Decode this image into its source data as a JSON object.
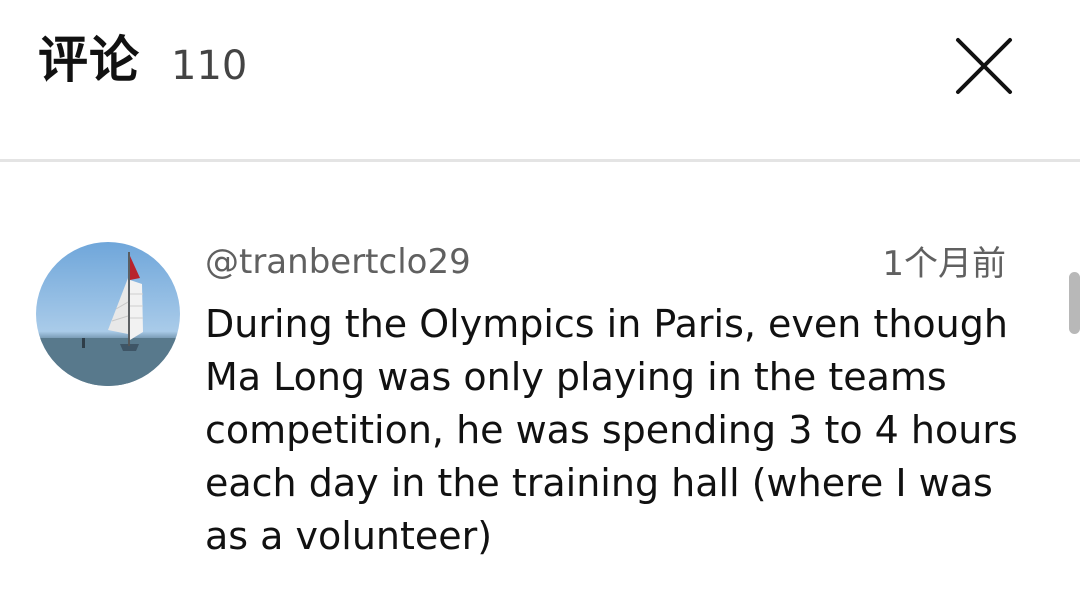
{
  "header": {
    "title": "评论",
    "count": "110",
    "close_icon": "close-icon"
  },
  "comment": {
    "avatar_icon": "sailboat-avatar",
    "username": "@tranbertclo29",
    "time": "1个月前",
    "text": "During the Olympics in Paris, even though Ma Long was only playing in the teams competition, he was spending 3 to 4 hours each day in the training hall (where I was as a volunteer)"
  }
}
